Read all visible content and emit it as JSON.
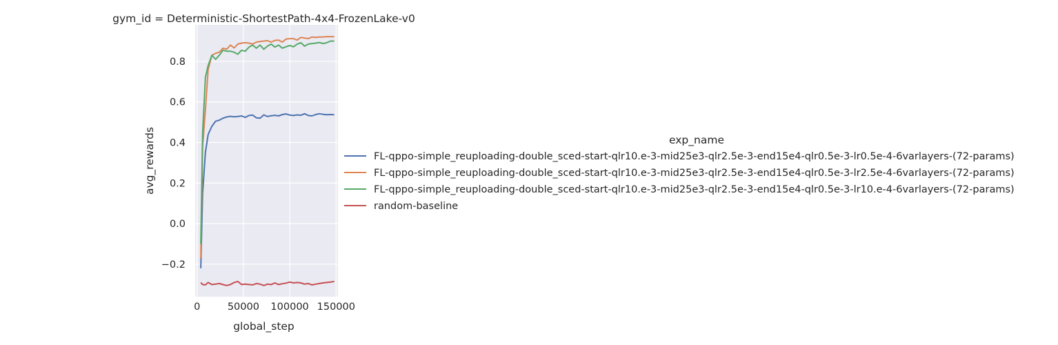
{
  "chart_data": {
    "type": "line",
    "title": "gym_id = Deterministic-ShortestPath-4x4-FrozenLake-v0",
    "xlabel": "global_step",
    "ylabel": "avg_rewards",
    "xlim": [
      -2000,
      152000
    ],
    "ylim": [
      -0.36,
      0.98
    ],
    "xticks": [
      0,
      50000,
      100000,
      150000
    ],
    "xtick_labels": [
      "0",
      "50000",
      "100000",
      "150000"
    ],
    "yticks": [
      -0.2,
      0.0,
      0.2,
      0.4,
      0.6,
      0.8
    ],
    "ytick_labels": [
      "−0.2",
      "0.0",
      "0.2",
      "0.4",
      "0.6",
      "0.8"
    ],
    "grid": true,
    "legend": {
      "title": "exp_name",
      "placement": "right"
    },
    "x": [
      4000,
      6000,
      9000,
      12000,
      16000,
      20000,
      24000,
      28000,
      32000,
      36000,
      40000,
      44000,
      48000,
      52000,
      56000,
      60000,
      64000,
      68000,
      72000,
      76000,
      80000,
      84000,
      88000,
      92000,
      96000,
      100000,
      104000,
      108000,
      112000,
      116000,
      120000,
      124000,
      128000,
      132000,
      136000,
      140000,
      144000,
      148000
    ],
    "series": [
      {
        "name": "FL-qppo-simple_reuploading-double_sced-start-qlr10.e-3-mid25e3-qlr2.5e-3-end15e4-qlr0.5e-3-lr0.5e-4-6varlayers-(72-params)",
        "color": "#4c72b0",
        "values": [
          -0.22,
          0.15,
          0.35,
          0.44,
          0.48,
          0.505,
          0.51,
          0.52,
          0.526,
          0.529,
          0.527,
          0.528,
          0.531,
          0.524,
          0.533,
          0.535,
          0.522,
          0.52,
          0.536,
          0.528,
          0.532,
          0.534,
          0.531,
          0.538,
          0.541,
          0.535,
          0.533,
          0.536,
          0.534,
          0.542,
          0.533,
          0.531,
          0.538,
          0.542,
          0.539,
          0.537,
          0.538,
          0.537
        ]
      },
      {
        "name": "FL-qppo-simple_reuploading-double_sced-start-qlr10.e-3-mid25e3-qlr2.5e-3-end15e4-qlr0.5e-3-lr2.5e-4-6varlayers-(72-params)",
        "color": "#dd8452",
        "values": [
          -0.17,
          0.38,
          0.56,
          0.76,
          0.83,
          0.84,
          0.845,
          0.865,
          0.86,
          0.88,
          0.866,
          0.885,
          0.89,
          0.892,
          0.89,
          0.885,
          0.895,
          0.898,
          0.9,
          0.902,
          0.895,
          0.903,
          0.905,
          0.895,
          0.91,
          0.912,
          0.912,
          0.905,
          0.918,
          0.915,
          0.912,
          0.92,
          0.918,
          0.92,
          0.92,
          0.922,
          0.922,
          0.922
        ]
      },
      {
        "name": "FL-qppo-simple_reuploading-double_sced-start-qlr10.e-3-mid25e3-qlr2.5e-3-end15e4-qlr0.5e-3-lr10.e-4-6varlayers-(72-params)",
        "color": "#55a868",
        "values": [
          -0.1,
          0.45,
          0.72,
          0.78,
          0.83,
          0.81,
          0.83,
          0.855,
          0.85,
          0.85,
          0.845,
          0.835,
          0.855,
          0.85,
          0.87,
          0.88,
          0.865,
          0.88,
          0.86,
          0.875,
          0.885,
          0.87,
          0.88,
          0.865,
          0.872,
          0.878,
          0.872,
          0.885,
          0.892,
          0.875,
          0.885,
          0.888,
          0.89,
          0.893,
          0.888,
          0.892,
          0.9,
          0.9
        ]
      },
      {
        "name": "random-baseline",
        "color": "#c44e52",
        "values": [
          -0.29,
          -0.3,
          -0.302,
          -0.29,
          -0.3,
          -0.298,
          -0.295,
          -0.3,
          -0.305,
          -0.3,
          -0.29,
          -0.285,
          -0.3,
          -0.298,
          -0.3,
          -0.302,
          -0.295,
          -0.298,
          -0.305,
          -0.298,
          -0.3,
          -0.292,
          -0.3,
          -0.296,
          -0.293,
          -0.288,
          -0.292,
          -0.29,
          -0.292,
          -0.298,
          -0.295,
          -0.302,
          -0.298,
          -0.295,
          -0.292,
          -0.29,
          -0.288,
          -0.285
        ]
      }
    ]
  }
}
